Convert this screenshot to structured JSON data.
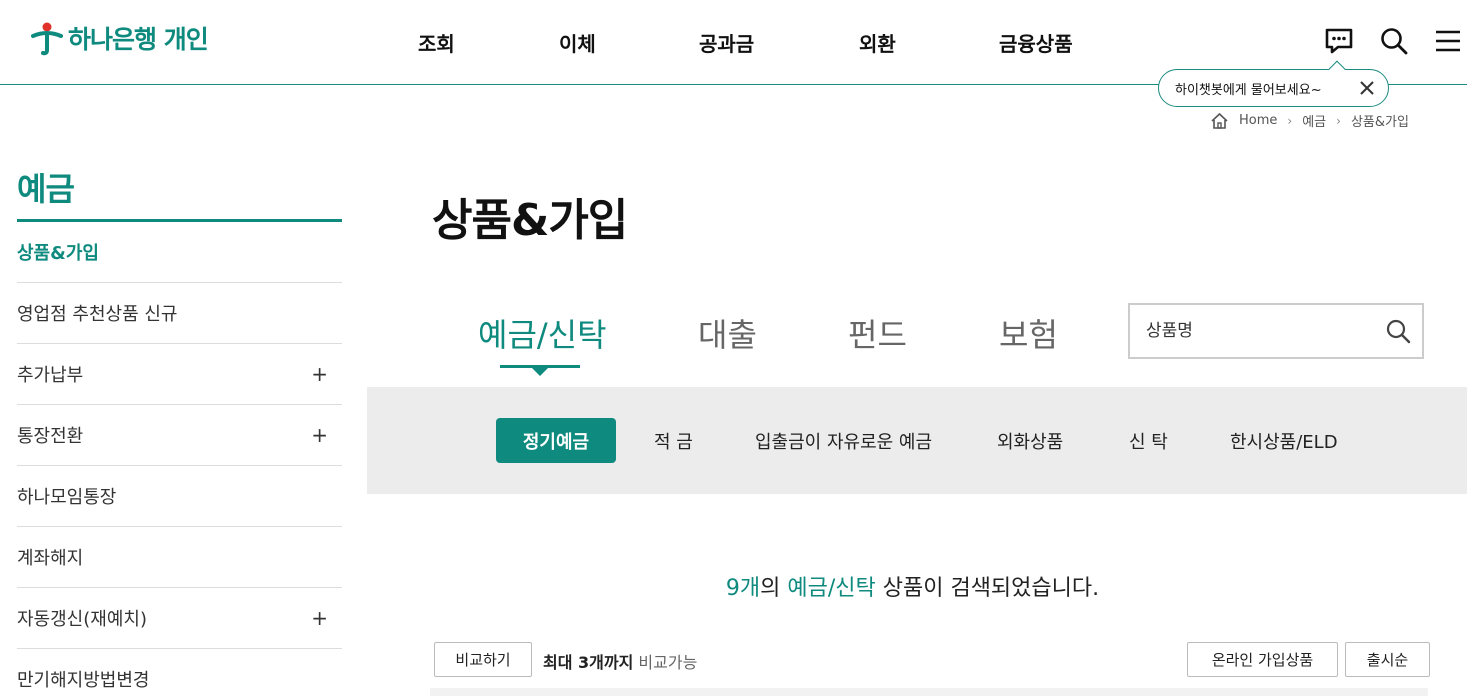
{
  "header": {
    "logo_text": "하나은행 개인",
    "nav": [
      "조회",
      "이체",
      "공과금",
      "외환",
      "금융상품"
    ],
    "icons": [
      "chatbot-icon",
      "search-icon",
      "menu-icon"
    ],
    "tooltip": "하이챗봇에게 물어보세요~"
  },
  "breadcrumb": {
    "home": "Home",
    "level1": "예금",
    "level2": "상품&가입"
  },
  "sidebar": {
    "title": "예금",
    "items": [
      {
        "label": "상품&가입",
        "active": true,
        "expandable": false
      },
      {
        "label": "영업점 추천상품 신규",
        "active": false,
        "expandable": false
      },
      {
        "label": "추가납부",
        "active": false,
        "expandable": true
      },
      {
        "label": "통장전환",
        "active": false,
        "expandable": true
      },
      {
        "label": "하나모임통장",
        "active": false,
        "expandable": false
      },
      {
        "label": "계좌해지",
        "active": false,
        "expandable": false
      },
      {
        "label": "자동갱신(재예치)",
        "active": false,
        "expandable": true
      },
      {
        "label": "만기해지방법변경",
        "active": false,
        "expandable": false
      }
    ],
    "plus_symbol": "+"
  },
  "main": {
    "title": "상품&가입",
    "tabs": [
      "예금/신탁",
      "대출",
      "펀드",
      "보험"
    ],
    "active_tab": "예금/신탁",
    "search_placeholder": "상품명",
    "subtabs": [
      "정기예금",
      "적 금",
      "입출금이 자유로운 예금",
      "외화상품",
      "신 탁",
      "한시상품/ELD"
    ],
    "active_subtab": "정기예금",
    "result": {
      "count": "9개",
      "connector": "의",
      "category": "예금/신탁",
      "suffix": "상품이 검색되었습니다."
    },
    "compare_button": "비교하기",
    "compare_note_bold": "최대 3개까지",
    "compare_note_rest": "비교가능",
    "online_button": "온라인 가입상품",
    "sort_button": "출시순"
  },
  "colors": {
    "brand": "#0f8a7e",
    "subtab_bg": "#ececec"
  }
}
